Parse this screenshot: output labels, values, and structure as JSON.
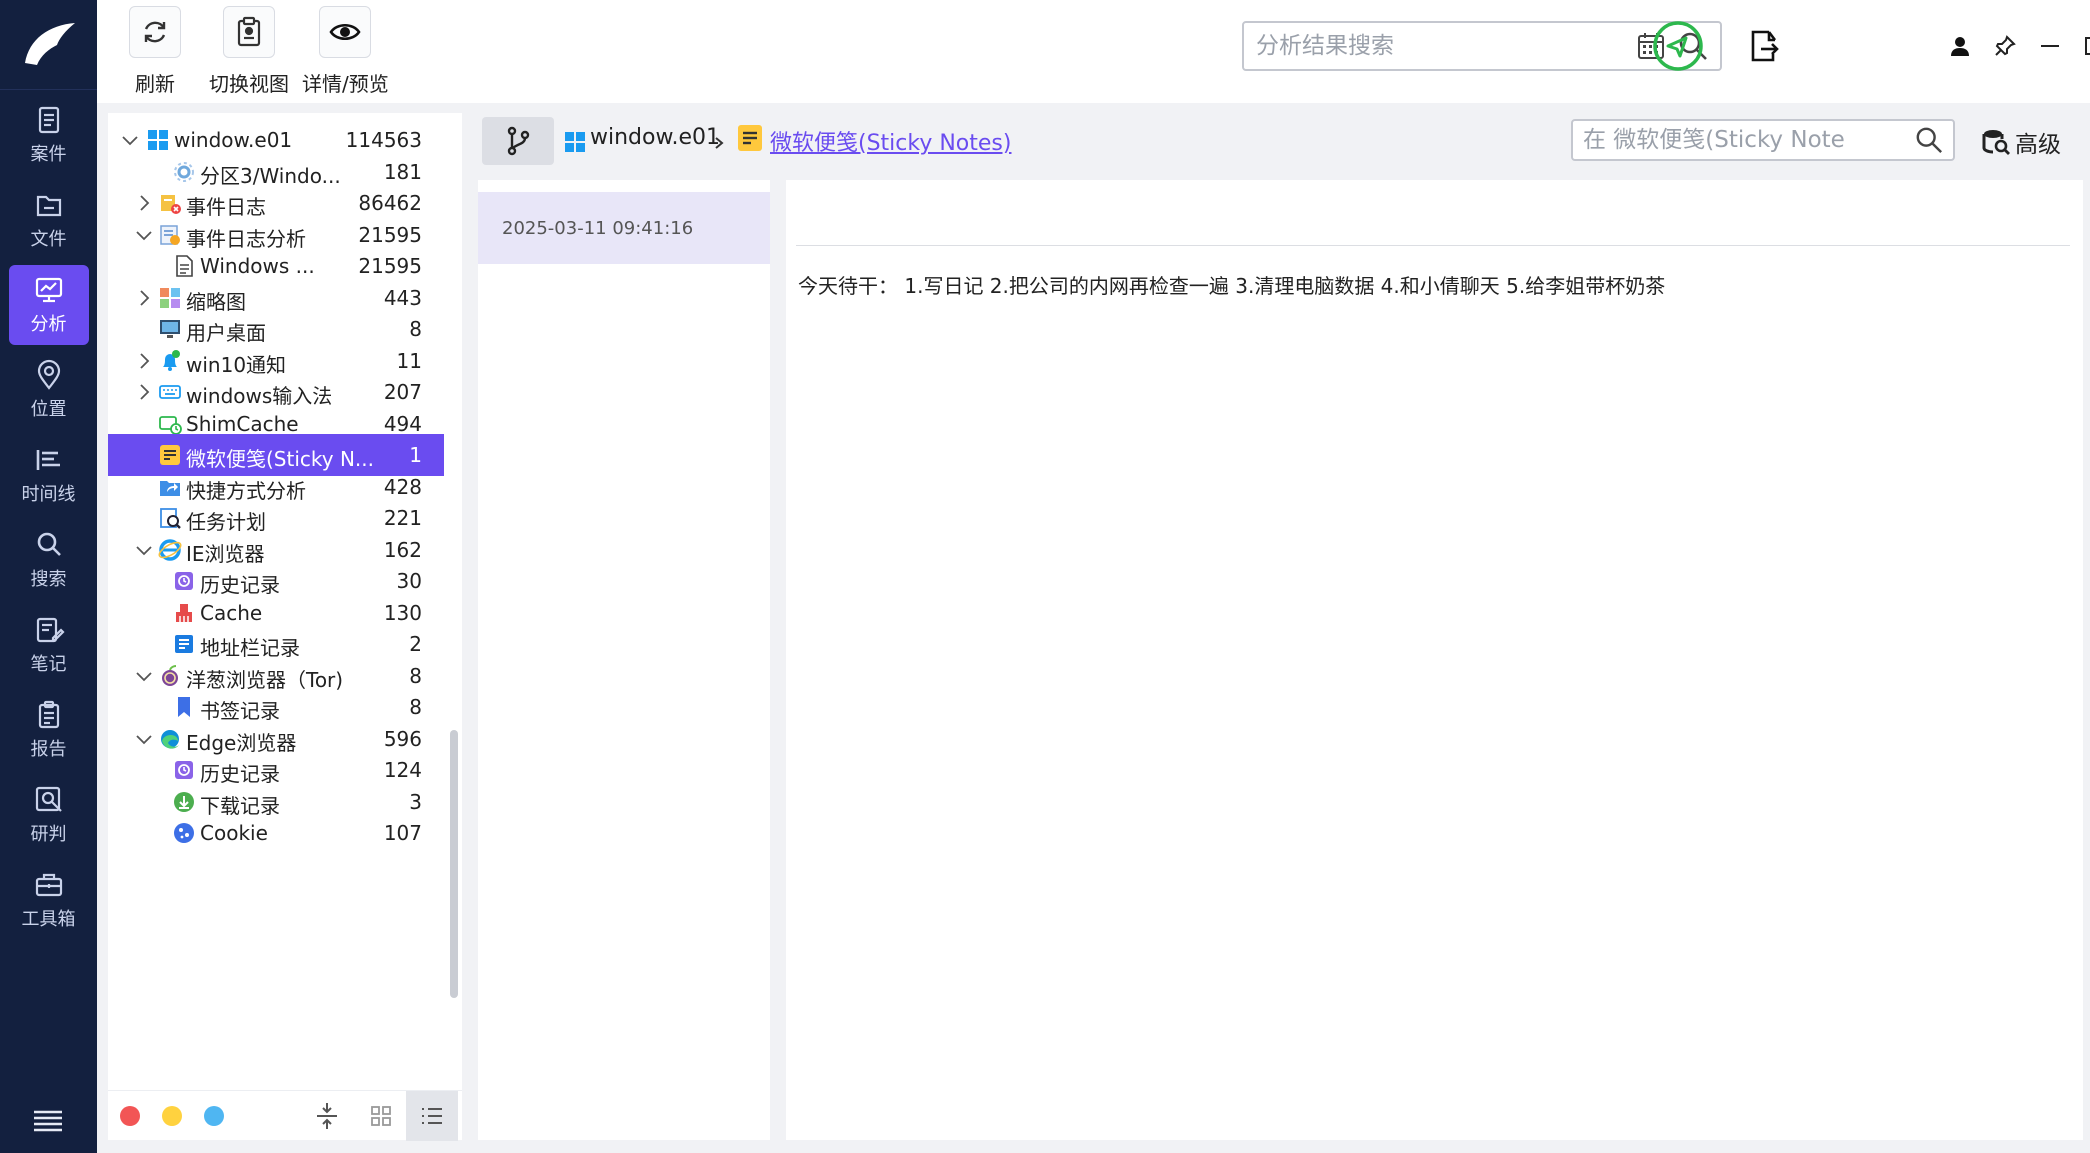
{
  "nav": {
    "items": [
      {
        "label": "案件",
        "icon": "case-icon"
      },
      {
        "label": "文件",
        "icon": "folder-icon"
      },
      {
        "label": "分析",
        "icon": "analysis-icon",
        "active": true
      },
      {
        "label": "位置",
        "icon": "location-icon"
      },
      {
        "label": "时间线",
        "icon": "timeline-icon"
      },
      {
        "label": "搜索",
        "icon": "search-icon"
      },
      {
        "label": "笔记",
        "icon": "note-icon"
      },
      {
        "label": "报告",
        "icon": "report-icon"
      },
      {
        "label": "研判",
        "icon": "judge-icon"
      },
      {
        "label": "工具箱",
        "icon": "toolbox-icon"
      }
    ]
  },
  "toolbar": {
    "refresh_label": "刷新",
    "switch_view_label": "切换视图",
    "detail_preview_label": "详情/预览",
    "search_placeholder": "分析结果搜索"
  },
  "tree": {
    "rows": [
      {
        "label": "window.e01",
        "count": "114563",
        "icon": "windows-icon",
        "expand": "down"
      },
      {
        "label": "分区3/Windo...",
        "count": "181",
        "icon": "partition-icon",
        "expand": "none"
      },
      {
        "label": "事件日志",
        "count": "86462",
        "icon": "event-log-icon",
        "expand": "right"
      },
      {
        "label": "事件日志分析",
        "count": "21595",
        "icon": "event-analysis-icon",
        "expand": "down"
      },
      {
        "label": "Windows ...",
        "count": "21595",
        "icon": "document-icon",
        "expand": "none"
      },
      {
        "label": "缩略图",
        "count": "443",
        "icon": "thumbnail-icon",
        "expand": "right"
      },
      {
        "label": "用户桌面",
        "count": "8",
        "icon": "desktop-icon",
        "expand": "none"
      },
      {
        "label": "win10通知",
        "count": "11",
        "icon": "bell-icon",
        "expand": "right"
      },
      {
        "label": "windows输入法",
        "count": "207",
        "icon": "keyboard-icon",
        "expand": "right"
      },
      {
        "label": "ShimCache",
        "count": "494",
        "icon": "shimcache-icon",
        "expand": "none"
      },
      {
        "label": "微软便笺(Sticky N...",
        "count": "1",
        "icon": "sticky-note-icon",
        "expand": "none",
        "selected": true
      },
      {
        "label": "快捷方式分析",
        "count": "428",
        "icon": "shortcut-icon",
        "expand": "none"
      },
      {
        "label": "任务计划",
        "count": "221",
        "icon": "task-icon",
        "expand": "none"
      },
      {
        "label": "IE浏览器",
        "count": "162",
        "icon": "ie-icon",
        "expand": "down"
      },
      {
        "label": "历史记录",
        "count": "30",
        "icon": "history-icon",
        "expand": "none"
      },
      {
        "label": "Cache",
        "count": "130",
        "icon": "cache-icon",
        "expand": "none"
      },
      {
        "label": "地址栏记录",
        "count": "2",
        "icon": "address-bar-icon",
        "expand": "none"
      },
      {
        "label": "洋葱浏览器（Tor)",
        "count": "8",
        "icon": "tor-icon",
        "expand": "down"
      },
      {
        "label": "书签记录",
        "count": "8",
        "icon": "bookmark-icon",
        "expand": "none"
      },
      {
        "label": "Edge浏览器",
        "count": "596",
        "icon": "edge-icon",
        "expand": "down"
      },
      {
        "label": "历史记录",
        "count": "124",
        "icon": "history-icon",
        "expand": "none"
      },
      {
        "label": "下载记录",
        "count": "3",
        "icon": "download-icon",
        "expand": "none"
      },
      {
        "label": "Cookie",
        "count": "107",
        "icon": "cookie-icon",
        "expand": "none"
      }
    ]
  },
  "breadcrumb": {
    "root": "window.e01",
    "current": "微软便笺(Sticky Notes)",
    "search_placeholder": "在 微软便笺(Sticky Note",
    "advanced_label": "高级"
  },
  "list": {
    "items": [
      {
        "timestamp": "2025-03-11 09:41:16"
      }
    ]
  },
  "content": {
    "text": "今天待干： 1.写日记 2.把公司的内网再检查一遍 3.清理电脑数据 4.和小倩聊天 5.给李姐带杯奶茶"
  },
  "colors": {
    "accent": "#6a4cf0",
    "rail_bg": "#13203f",
    "panel_bg": "#f1f2f5",
    "status_green": "#2db84d"
  }
}
